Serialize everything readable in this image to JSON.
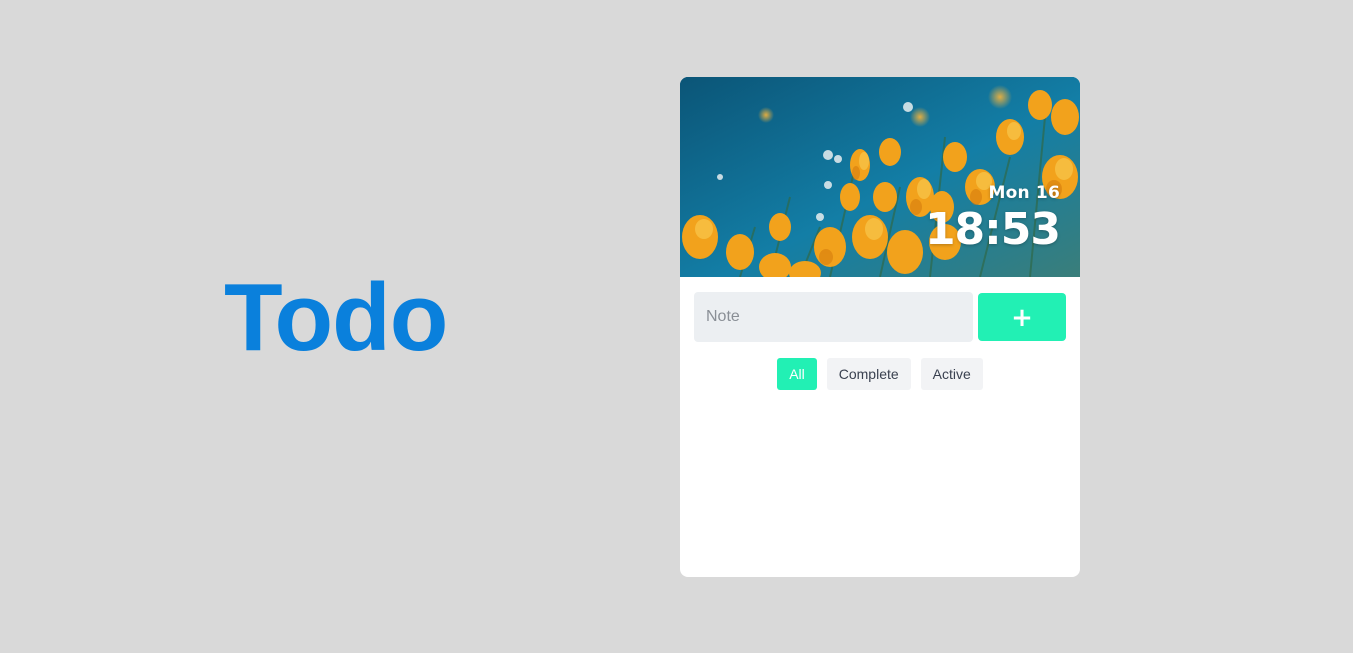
{
  "brand": {
    "title": "Todo",
    "color": "#0a80dc"
  },
  "hero": {
    "image": "orange-poppies-sky-photo",
    "date": "Mon 16",
    "time": "18:53"
  },
  "composer": {
    "placeholder": "Note",
    "value": "",
    "add_label": "+",
    "add_icon": "plus-icon"
  },
  "filters": [
    {
      "label": "All",
      "active": true
    },
    {
      "label": "Complete",
      "active": false
    },
    {
      "label": "Active",
      "active": false
    }
  ],
  "todos": [],
  "colors": {
    "background": "#d9d9d9",
    "accent": "#22f0b4",
    "input_bg": "#eceff2",
    "filter_bg": "#f2f3f5"
  }
}
